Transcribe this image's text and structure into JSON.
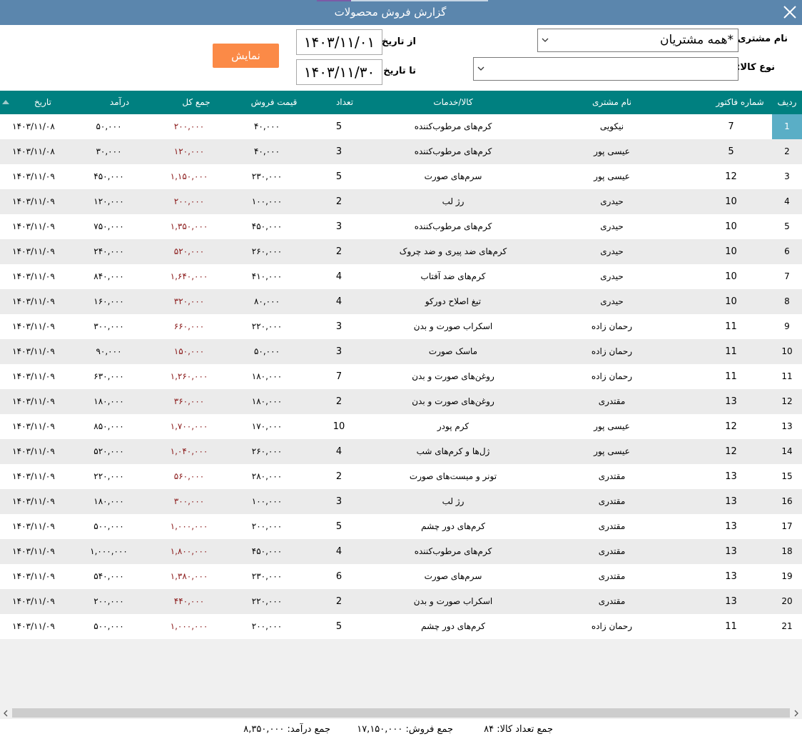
{
  "window": {
    "title": "گزارش فروش محصولات"
  },
  "filters": {
    "customer_label": "نام مشتری:",
    "customer_value": "*همه مشتریان",
    "product_type_label": "نوع کالا:",
    "product_type_value": "",
    "from_label": "از تاریخ:",
    "from_value": "۱۴۰۳/۱۱/۰۱",
    "to_label": "تا تاریخ:",
    "to_value": "۱۴۰۳/۱۱/۳۰",
    "show_button": "نمایش"
  },
  "table": {
    "headers": {
      "row": "ردیف",
      "invoice": "شماره فاکتور",
      "customer": "نام مشتری",
      "product": "کالا/خدمات",
      "qty": "تعداد",
      "price": "قیمت فروش",
      "total": "جمع کل",
      "revenue": "درآمد",
      "date": "تاریخ"
    },
    "rows": [
      {
        "row": "1",
        "invoice": "7",
        "customer": "نیکویی",
        "product": "کرم‌های مرطوب‌کننده",
        "qty": "5",
        "price": "۴۰,۰۰۰",
        "total": "۲۰۰,۰۰۰",
        "revenue": "۵۰,۰۰۰",
        "date": "۱۴۰۳/۱۱/۰۸"
      },
      {
        "row": "2",
        "invoice": "5",
        "customer": "عیسی پور",
        "product": "کرم‌های مرطوب‌کننده",
        "qty": "3",
        "price": "۴۰,۰۰۰",
        "total": "۱۲۰,۰۰۰",
        "revenue": "۳۰,۰۰۰",
        "date": "۱۴۰۳/۱۱/۰۸"
      },
      {
        "row": "3",
        "invoice": "12",
        "customer": "عیسی پور",
        "product": "سرم‌های صورت",
        "qty": "5",
        "price": "۲۳۰,۰۰۰",
        "total": "۱,۱۵۰,۰۰۰",
        "revenue": "۴۵۰,۰۰۰",
        "date": "۱۴۰۳/۱۱/۰۹"
      },
      {
        "row": "4",
        "invoice": "10",
        "customer": "حیدری",
        "product": "رژ لب",
        "qty": "2",
        "price": "۱۰۰,۰۰۰",
        "total": "۲۰۰,۰۰۰",
        "revenue": "۱۲۰,۰۰۰",
        "date": "۱۴۰۳/۱۱/۰۹"
      },
      {
        "row": "5",
        "invoice": "10",
        "customer": "حیدری",
        "product": "کرم‌های مرطوب‌کننده",
        "qty": "3",
        "price": "۴۵۰,۰۰۰",
        "total": "۱,۳۵۰,۰۰۰",
        "revenue": "۷۵۰,۰۰۰",
        "date": "۱۴۰۳/۱۱/۰۹"
      },
      {
        "row": "6",
        "invoice": "10",
        "customer": "حیدری",
        "product": "کرم‌های ضد پیری و ضد چروک",
        "qty": "2",
        "price": "۲۶۰,۰۰۰",
        "total": "۵۲۰,۰۰۰",
        "revenue": "۲۴۰,۰۰۰",
        "date": "۱۴۰۳/۱۱/۰۹"
      },
      {
        "row": "7",
        "invoice": "10",
        "customer": "حیدری",
        "product": "کرم‌های ضد آفتاب",
        "qty": "4",
        "price": "۴۱۰,۰۰۰",
        "total": "۱,۶۴۰,۰۰۰",
        "revenue": "۸۴۰,۰۰۰",
        "date": "۱۴۰۳/۱۱/۰۹"
      },
      {
        "row": "8",
        "invoice": "10",
        "customer": "حیدری",
        "product": "تیغ اصلاح دورکو",
        "qty": "4",
        "price": "۸۰,۰۰۰",
        "total": "۳۲۰,۰۰۰",
        "revenue": "۱۶۰,۰۰۰",
        "date": "۱۴۰۳/۱۱/۰۹"
      },
      {
        "row": "9",
        "invoice": "11",
        "customer": "رحمان زاده",
        "product": "اسکراب صورت و بدن",
        "qty": "3",
        "price": "۲۲۰,۰۰۰",
        "total": "۶۶۰,۰۰۰",
        "revenue": "۳۰۰,۰۰۰",
        "date": "۱۴۰۳/۱۱/۰۹"
      },
      {
        "row": "10",
        "invoice": "11",
        "customer": "رحمان زاده",
        "product": "ماسک صورت",
        "qty": "3",
        "price": "۵۰,۰۰۰",
        "total": "۱۵۰,۰۰۰",
        "revenue": "۹۰,۰۰۰",
        "date": "۱۴۰۳/۱۱/۰۹"
      },
      {
        "row": "11",
        "invoice": "11",
        "customer": "رحمان زاده",
        "product": "روغن‌های صورت و بدن",
        "qty": "7",
        "price": "۱۸۰,۰۰۰",
        "total": "۱,۲۶۰,۰۰۰",
        "revenue": "۶۳۰,۰۰۰",
        "date": "۱۴۰۳/۱۱/۰۹"
      },
      {
        "row": "12",
        "invoice": "13",
        "customer": "مقتدری",
        "product": "روغن‌های صورت و بدن",
        "qty": "2",
        "price": "۱۸۰,۰۰۰",
        "total": "۳۶۰,۰۰۰",
        "revenue": "۱۸۰,۰۰۰",
        "date": "۱۴۰۳/۱۱/۰۹"
      },
      {
        "row": "13",
        "invoice": "12",
        "customer": "عیسی پور",
        "product": "کرم پودر",
        "qty": "10",
        "price": "۱۷۰,۰۰۰",
        "total": "۱,۷۰۰,۰۰۰",
        "revenue": "۸۵۰,۰۰۰",
        "date": "۱۴۰۳/۱۱/۰۹"
      },
      {
        "row": "14",
        "invoice": "12",
        "customer": "عیسی پور",
        "product": "ژل‌ها و کرم‌های شب",
        "qty": "4",
        "price": "۲۶۰,۰۰۰",
        "total": "۱,۰۴۰,۰۰۰",
        "revenue": "۵۲۰,۰۰۰",
        "date": "۱۴۰۳/۱۱/۰۹"
      },
      {
        "row": "15",
        "invoice": "13",
        "customer": "مقتدری",
        "product": "تونر و میست‌های صورت",
        "qty": "2",
        "price": "۲۸۰,۰۰۰",
        "total": "۵۶۰,۰۰۰",
        "revenue": "۲۲۰,۰۰۰",
        "date": "۱۴۰۳/۱۱/۰۹"
      },
      {
        "row": "16",
        "invoice": "13",
        "customer": "مقتدری",
        "product": "رژ لب",
        "qty": "3",
        "price": "۱۰۰,۰۰۰",
        "total": "۳۰۰,۰۰۰",
        "revenue": "۱۸۰,۰۰۰",
        "date": "۱۴۰۳/۱۱/۰۹"
      },
      {
        "row": "17",
        "invoice": "13",
        "customer": "مقتدری",
        "product": "کرم‌های دور چشم",
        "qty": "5",
        "price": "۲۰۰,۰۰۰",
        "total": "۱,۰۰۰,۰۰۰",
        "revenue": "۵۰۰,۰۰۰",
        "date": "۱۴۰۳/۱۱/۰۹"
      },
      {
        "row": "18",
        "invoice": "13",
        "customer": "مقتدری",
        "product": "کرم‌های مرطوب‌کننده",
        "qty": "4",
        "price": "۴۵۰,۰۰۰",
        "total": "۱,۸۰۰,۰۰۰",
        "revenue": "۱,۰۰۰,۰۰۰",
        "date": "۱۴۰۳/۱۱/۰۹"
      },
      {
        "row": "19",
        "invoice": "13",
        "customer": "مقتدری",
        "product": "سرم‌های صورت",
        "qty": "6",
        "price": "۲۳۰,۰۰۰",
        "total": "۱,۳۸۰,۰۰۰",
        "revenue": "۵۴۰,۰۰۰",
        "date": "۱۴۰۳/۱۱/۰۹"
      },
      {
        "row": "20",
        "invoice": "13",
        "customer": "مقتدری",
        "product": "اسکراب صورت و بدن",
        "qty": "2",
        "price": "۲۲۰,۰۰۰",
        "total": "۴۴۰,۰۰۰",
        "revenue": "۲۰۰,۰۰۰",
        "date": "۱۴۰۳/۱۱/۰۹"
      },
      {
        "row": "21",
        "invoice": "11",
        "customer": "رحمان زاده",
        "product": "کرم‌های دور چشم",
        "qty": "5",
        "price": "۲۰۰,۰۰۰",
        "total": "۱,۰۰۰,۰۰۰",
        "revenue": "۵۰۰,۰۰۰",
        "date": "۱۴۰۳/۱۱/۰۹"
      }
    ]
  },
  "footer": {
    "total_qty": "جمع تعداد کالا: ۸۴",
    "total_sales": "جمع فروش: ۱۷,۱۵۰,۰۰۰",
    "total_revenue": "جمع درآمد: ۸,۳۵۰,۰۰۰"
  },
  "colors": {
    "titlebar": "#5b86ad",
    "header": "#008080",
    "button": "#fb8a47",
    "selected_row_cell": "#5aaec6",
    "total_text": "#8b1a1a"
  }
}
